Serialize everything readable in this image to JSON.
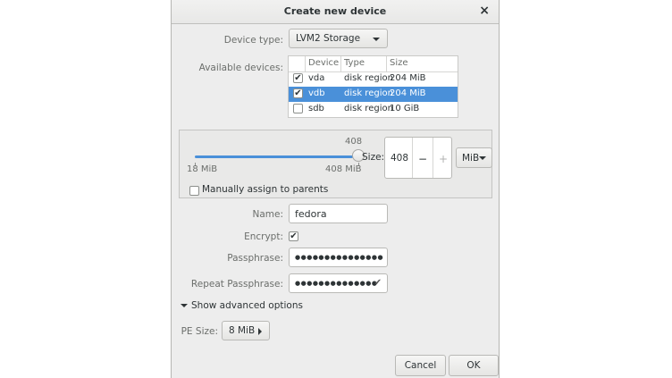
{
  "dialog": {
    "title": "Create new device"
  },
  "device_type": {
    "label": "Device type:",
    "value": "LVM2 Storage"
  },
  "available_devices": {
    "label": "Available devices:",
    "columns": [
      "Device",
      "Type",
      "Size"
    ],
    "rows": [
      {
        "checked": true,
        "selected": false,
        "device": "vda",
        "type": "disk region",
        "size": "204 MiB"
      },
      {
        "checked": true,
        "selected": true,
        "device": "vdb",
        "type": "disk region",
        "size": "204 MiB"
      },
      {
        "checked": false,
        "selected": false,
        "device": "sdb",
        "type": "disk region",
        "size": "10 GiB"
      }
    ]
  },
  "size": {
    "slider_value": "408",
    "min_label": "18 MiB",
    "max_label": "408 MiB",
    "slider_fraction": 1.0,
    "label": "Size:",
    "value": "408",
    "minus": "−",
    "plus": "+",
    "unit": "MiB",
    "manual_assign_label": "Manually assign to parents",
    "manual_assign_checked": false
  },
  "name": {
    "label": "Name:",
    "value": "fedora"
  },
  "encrypt": {
    "label": "Encrypt:",
    "checked": true
  },
  "passphrase": {
    "label": "Passphrase:",
    "dots": "●●●●●●●●●●●●●●●"
  },
  "repeat_passphrase": {
    "label": "Repeat Passphrase:",
    "dots": "●●●●●●●●●●●●●●",
    "match_mark": "✔"
  },
  "advanced": {
    "label": "Show advanced options"
  },
  "pe_size": {
    "label": "PE Size:",
    "value": "8 MiB"
  },
  "footer": {
    "cancel": "Cancel",
    "ok": "OK"
  },
  "colors": {
    "accent": "#4a90d9",
    "window_bg": "#ededed"
  }
}
